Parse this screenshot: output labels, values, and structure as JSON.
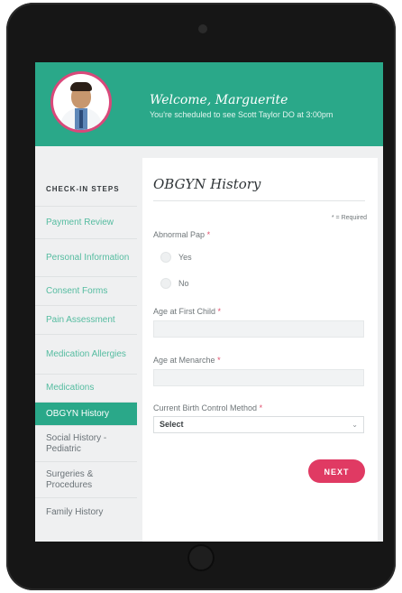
{
  "header": {
    "welcome": "Welcome, Marguerite",
    "subtitle": "You're scheduled to see Scott Taylor DO at 3:00pm"
  },
  "sidebar": {
    "title": "CHECK-IN STEPS",
    "items": [
      {
        "label": "Payment Review",
        "state": "done"
      },
      {
        "label": "Personal Information",
        "state": "done"
      },
      {
        "label": "Consent Forms",
        "state": "done"
      },
      {
        "label": "Pain Assessment",
        "state": "done"
      },
      {
        "label": "Medication Allergies",
        "state": "done"
      },
      {
        "label": "Medications",
        "state": "done"
      },
      {
        "label": "OBGYN History",
        "state": "active"
      },
      {
        "label": "Social History - Pediatric",
        "state": "todo"
      },
      {
        "label": "Surgeries & Procedures",
        "state": "todo"
      },
      {
        "label": "Family History",
        "state": "todo"
      }
    ]
  },
  "form": {
    "title": "OBGYN History",
    "required_note": "* = Required",
    "abnormal_pap_label": "Abnormal Pap",
    "options": [
      "Yes",
      "No"
    ],
    "first_child_label": "Age at First Child",
    "first_child_value": "",
    "menarche_label": "Age at Menarche",
    "menarche_value": "",
    "birth_control_label": "Current Birth Control Method",
    "birth_control_value": "Select",
    "next_label": "NEXT"
  },
  "colors": {
    "brand_teal": "#2aa889",
    "accent_pink": "#e03a63"
  }
}
